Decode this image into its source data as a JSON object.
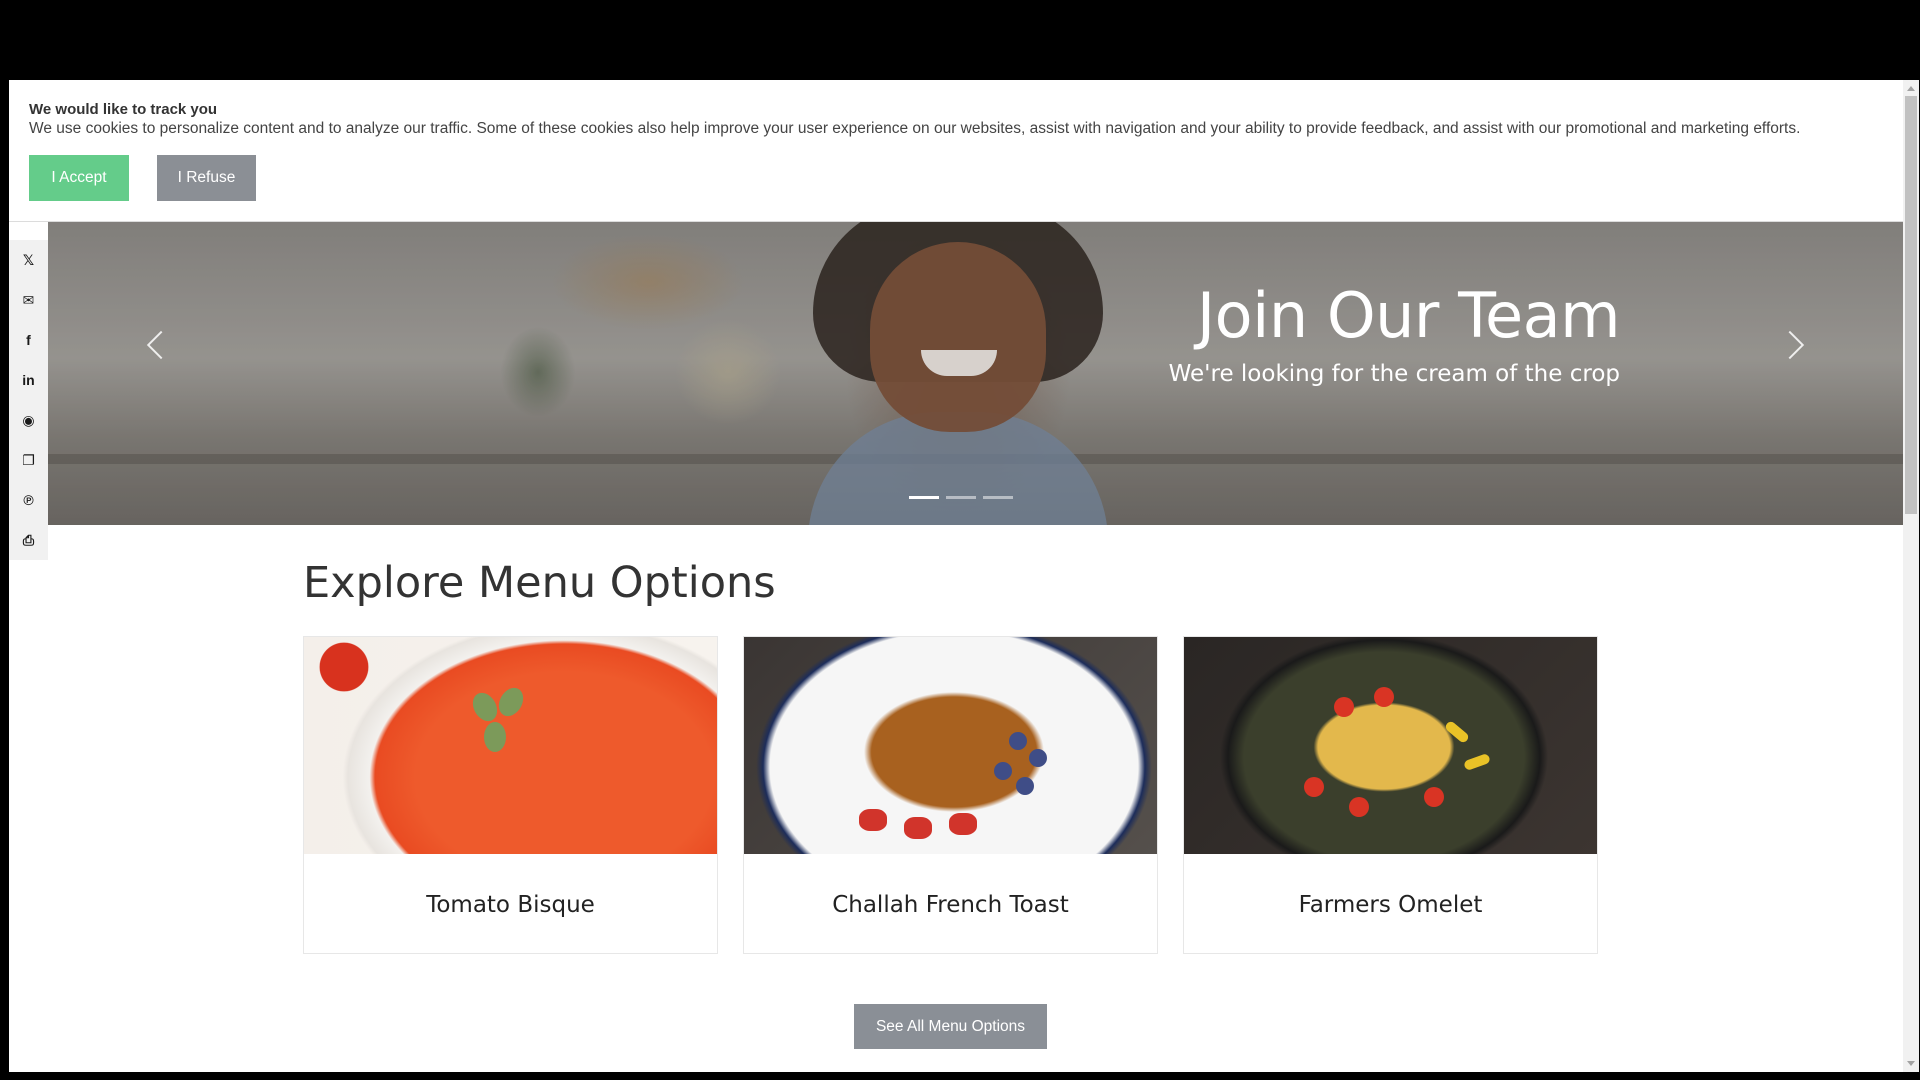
{
  "cookie_banner": {
    "title": "We would like to track you",
    "text": "We use cookies to personalize content and to analyze our traffic. Some of these cookies also help improve your user experience on our websites, assist with navigation and your ability to provide feedback, and assist with our promotional and marketing efforts.",
    "accept_label": "I Accept",
    "refuse_label": "I Refuse",
    "accept_color": "#64cc8a",
    "refuse_color": "#8b8f95"
  },
  "share_rail": {
    "items": [
      {
        "icon": "x-icon",
        "glyph": "𝕏"
      },
      {
        "icon": "email-icon",
        "glyph": "✉"
      },
      {
        "icon": "facebook-icon",
        "glyph": "f"
      },
      {
        "icon": "linkedin-icon",
        "glyph": "in"
      },
      {
        "icon": "messenger-icon",
        "glyph": "◉"
      },
      {
        "icon": "copy-link-icon",
        "glyph": "❐"
      },
      {
        "icon": "pinterest-icon",
        "glyph": "℗"
      },
      {
        "icon": "print-icon",
        "glyph": "⎙"
      }
    ]
  },
  "hero": {
    "title": "Join Our Team",
    "subtitle": "We're looking for the cream of the crop",
    "slide_count": 3,
    "active_slide": 1
  },
  "menu": {
    "heading": "Explore Menu Options",
    "items": [
      {
        "name": "Tomato Bisque"
      },
      {
        "name": "Challah French Toast"
      },
      {
        "name": "Farmers Omelet"
      }
    ],
    "see_all_label": "See All Menu Options",
    "button_color": "#8a8f96"
  }
}
